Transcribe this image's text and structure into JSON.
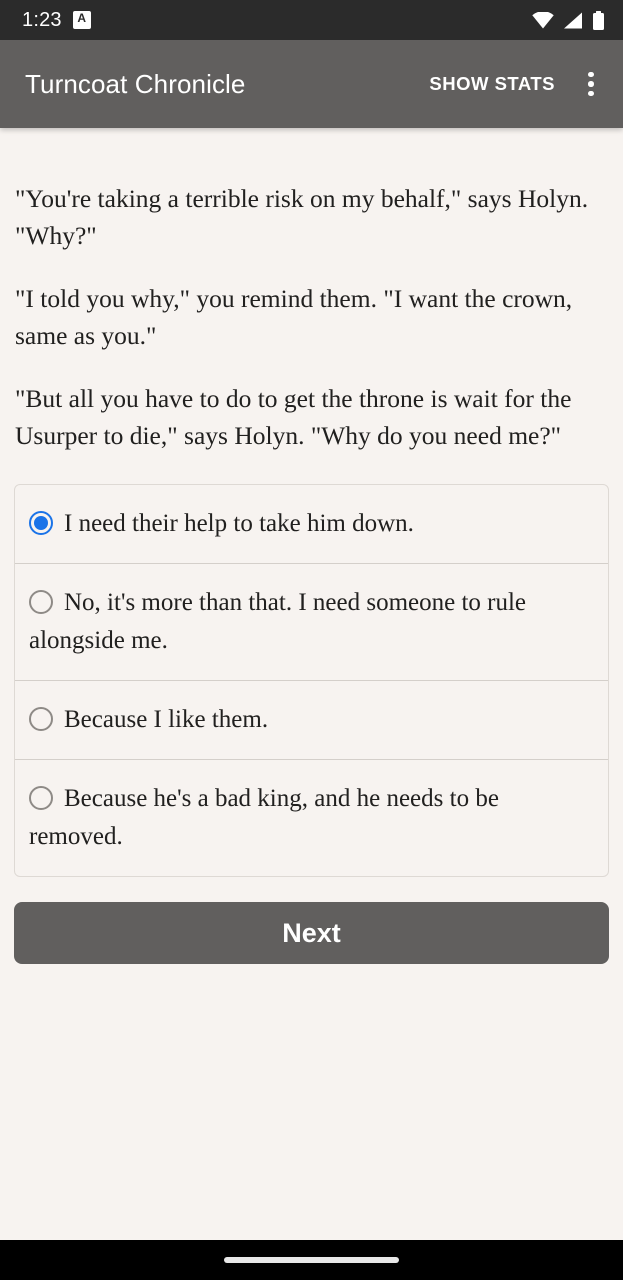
{
  "status_bar": {
    "time": "1:23",
    "notification_badge": "A",
    "icons": [
      "wifi-icon",
      "cellular-signal-icon",
      "battery-icon"
    ],
    "background_color": "#2b2b2b"
  },
  "app_bar": {
    "title": "Turncoat Chronicle",
    "action_label": "SHOW STATS",
    "overflow_icon": "more-vertical-icon",
    "background_color": "#615f5e",
    "text_color": "#ffffff"
  },
  "story": {
    "paragraphs": [
      "\"You're taking a terrible risk on my behalf,\" says Holyn. \"Why?\"",
      "\"I told you why,\" you remind them. \"I want the crown, same as you.\"",
      "\"But all you have to do to get the throne is wait for the Usurper to die,\" says Holyn. \"Why do you need me?\""
    ]
  },
  "choices": {
    "selected_index": 0,
    "selected_color": "#1a73e8",
    "options": [
      {
        "label": "I need their help to take him down.",
        "selected": true
      },
      {
        "label": "No, it's more than that. I need someone to rule alongside me.",
        "selected": false
      },
      {
        "label": "Because I like them.",
        "selected": false
      },
      {
        "label": "Because he's a bad king, and he needs to be removed.",
        "selected": false
      }
    ]
  },
  "next_button": {
    "label": "Next",
    "background_color": "#615f5e"
  },
  "nav_bar": {
    "gesture_pill": "home-gesture-pill",
    "background_color": "#000000"
  },
  "theme": {
    "page_background": "#f7f3f0",
    "body_text_color": "#21201f",
    "divider_color": "#d4cfca"
  }
}
